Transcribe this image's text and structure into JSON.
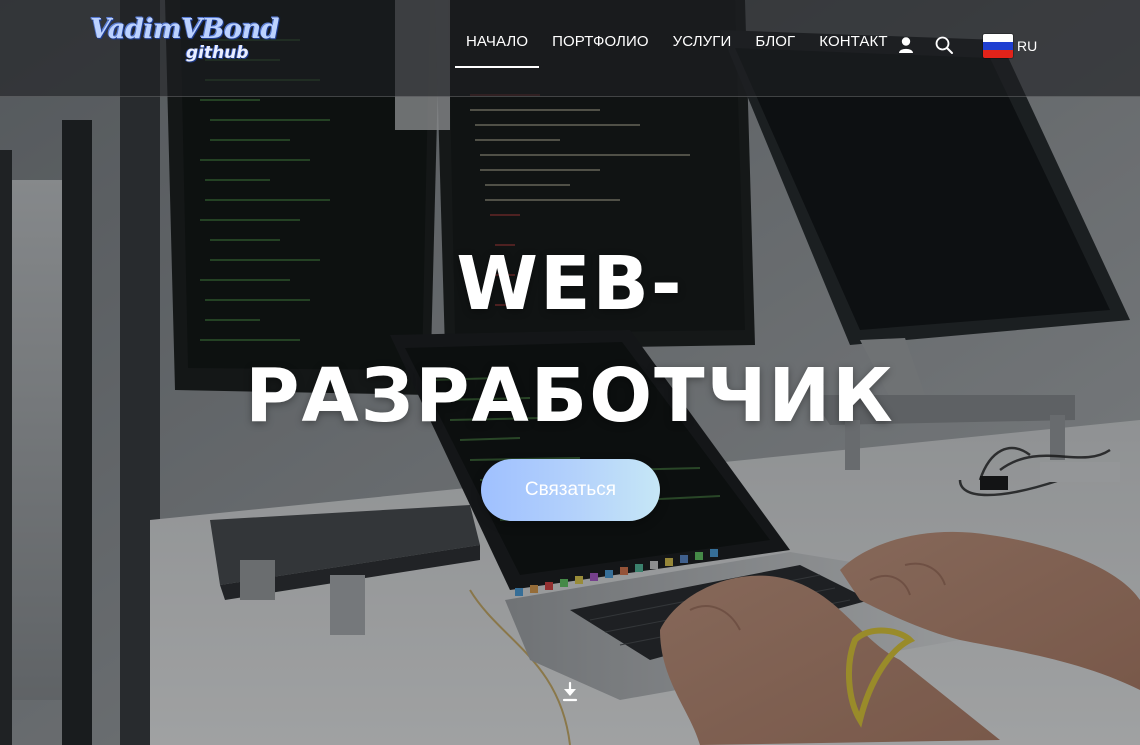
{
  "header": {
    "logo": {
      "main": "VadimVBond",
      "sub": "github"
    },
    "nav": [
      {
        "label": "НАЧАЛО",
        "active": true
      },
      {
        "label": "ПОРТФОЛИО",
        "active": false
      },
      {
        "label": "УСЛУГИ",
        "active": false
      },
      {
        "label": "БЛОГ",
        "active": false
      },
      {
        "label": "КОНТАКТ",
        "active": false
      }
    ],
    "icons": {
      "user": "user-icon",
      "search": "search-icon",
      "scroll": "arrow-down-icon",
      "flag": "russia-flag-icon"
    },
    "language": "RU"
  },
  "hero": {
    "title_line1": "WEB-",
    "title_line2": "РАЗРАБОТЧИК",
    "cta_label": "Связаться"
  },
  "colors": {
    "accent_gradient_start": "#9fc0ff",
    "accent_gradient_end": "#c6e7f6",
    "text": "#ffffff",
    "overlay": "#1e2124"
  }
}
